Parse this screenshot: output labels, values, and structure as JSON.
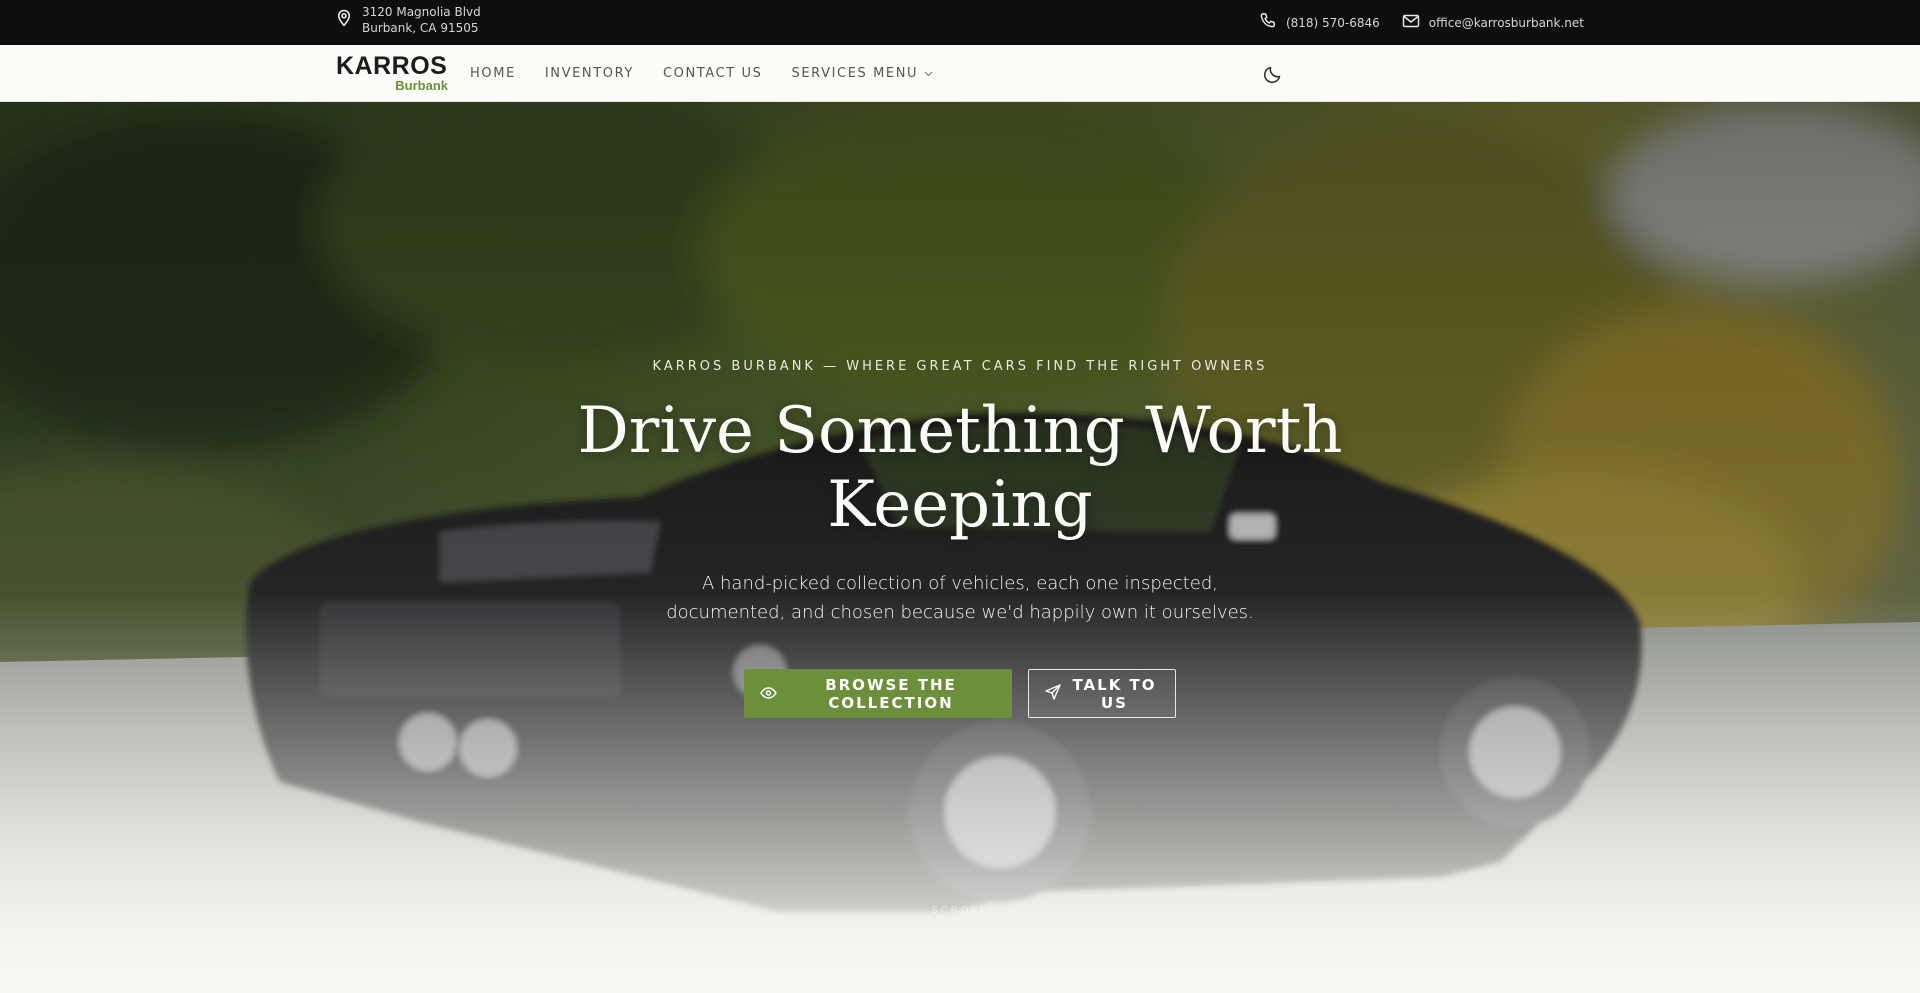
{
  "topbar": {
    "address_line1": "3120 Magnolia Blvd",
    "address_line2": "Burbank, CA 91505",
    "phone": "(818) 570-6846",
    "email": "office@karrosburbank.net",
    "icons": [
      "map-pin-icon",
      "phone-icon",
      "mail-icon"
    ]
  },
  "nav": {
    "logo_brand": "KARROS",
    "logo_sub": "Burbank",
    "items": [
      {
        "label": "HOME"
      },
      {
        "label": "INVENTORY"
      },
      {
        "label": "CONTACT US"
      },
      {
        "label": "SERVICES MENU"
      }
    ],
    "theme_toggle_icon": "moon-icon"
  },
  "hero": {
    "eyebrow": "KARROS BURBANK — WHERE GREAT CARS FIND THE RIGHT OWNERS",
    "headline_line1": "Drive Something Worth",
    "headline_line2": "Keeping",
    "lead": "A hand-picked collection of vehicles, each one inspected, documented, and chosen because we'd happily own it ourselves.",
    "primary_cta": "BROWSE THE COLLECTION",
    "secondary_cta": "TALK TO US",
    "scroll_label": "SCROLL"
  },
  "colors": {
    "accent": "#6b8f3a",
    "topbar_bg": "#0d0e0d",
    "nav_bg": "#fbfcf8",
    "page_bg": "#f8f9f4"
  }
}
